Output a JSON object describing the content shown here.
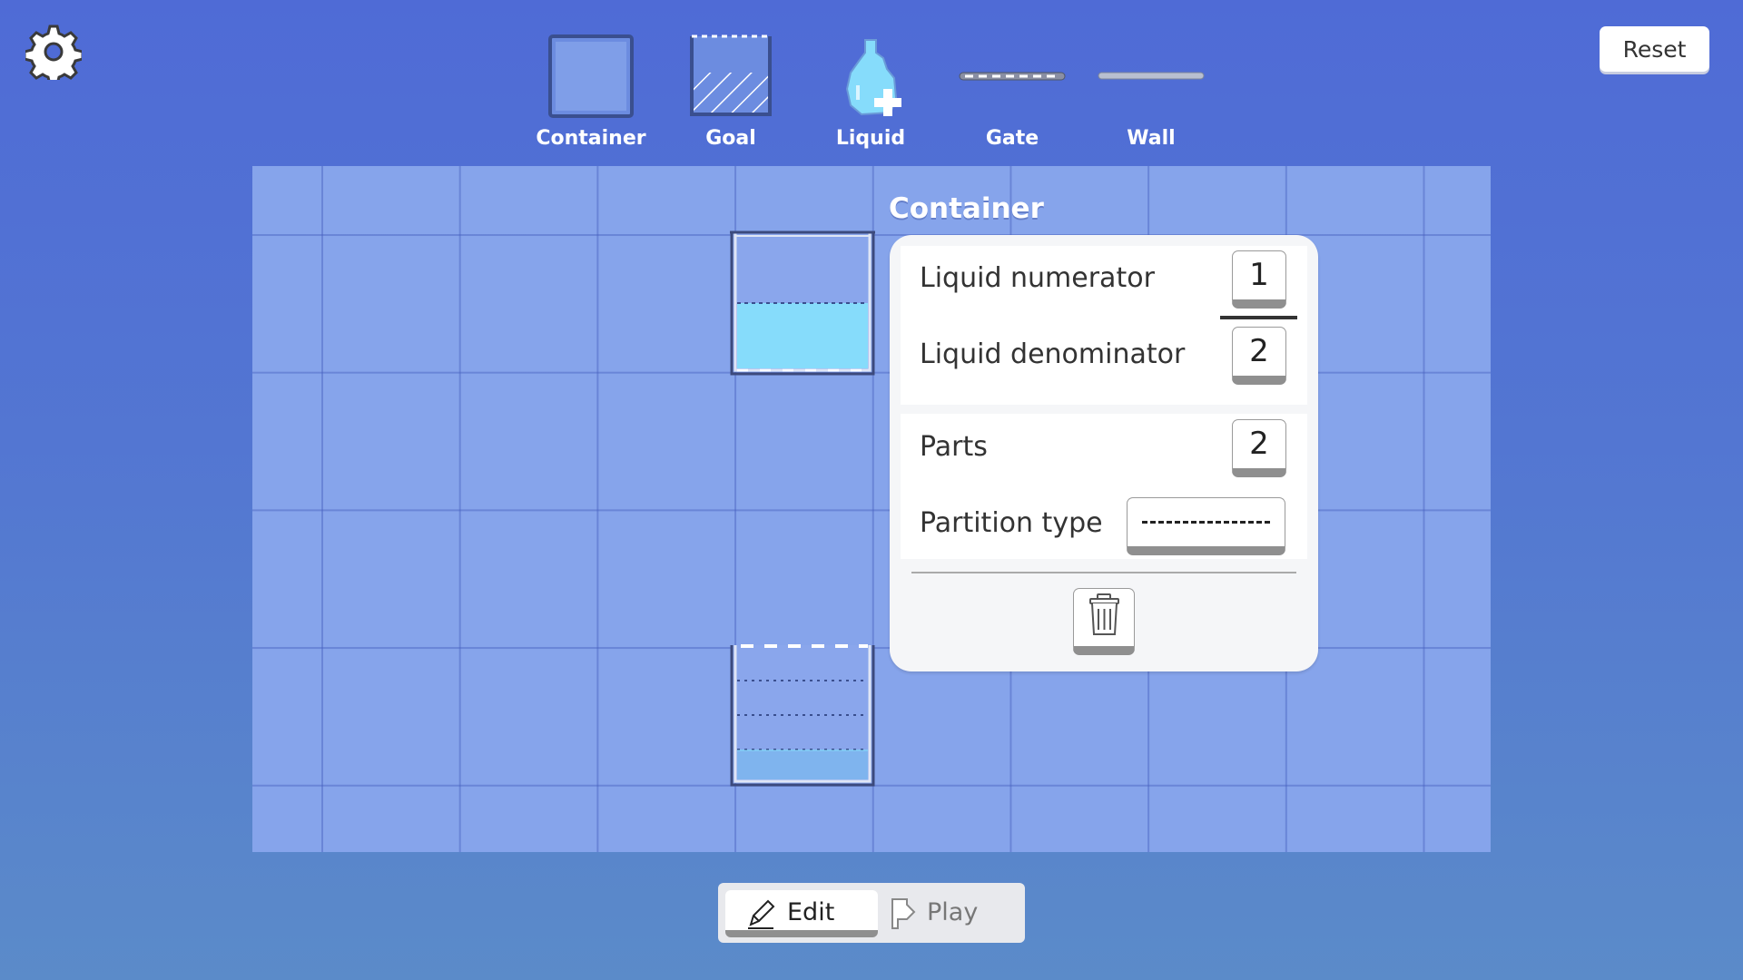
{
  "settings": {
    "icon": "gear-icon"
  },
  "header": {
    "reset_label": "Reset"
  },
  "toolbar": {
    "tools": [
      {
        "label": "Container",
        "icon": "container-icon"
      },
      {
        "label": "Goal",
        "icon": "goal-icon"
      },
      {
        "label": "Liquid",
        "icon": "liquid-drop-plus-icon"
      },
      {
        "label": "Gate",
        "icon": "gate-icon"
      },
      {
        "label": "Wall",
        "icon": "wall-icon"
      }
    ]
  },
  "board": {
    "containers": [
      {
        "name": "upper-container",
        "liquid_fraction": 0.5,
        "parts": 2
      },
      {
        "name": "lower-container",
        "liquid_fraction": 0.25,
        "parts": 4
      }
    ]
  },
  "panel": {
    "title": "Container",
    "liquid_numerator_label": "Liquid numerator",
    "liquid_numerator_value": "1",
    "liquid_denominator_label": "Liquid denominator",
    "liquid_denominator_value": "2",
    "parts_label": "Parts",
    "parts_value": "2",
    "partition_type_label": "Partition type",
    "partition_type_value": "dashed",
    "delete_icon": "trash-icon"
  },
  "mode": {
    "edit_label": "Edit",
    "play_label": "Play",
    "active": "Edit"
  },
  "colors": {
    "background_top": "#4f6bd6",
    "background_bottom": "#5b8bc9",
    "board": "#86a4eb",
    "liquid": "#86dcfb"
  }
}
